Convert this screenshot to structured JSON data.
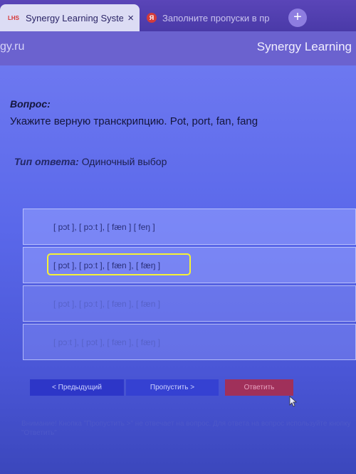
{
  "browser": {
    "tabs": [
      {
        "favicon": "LHS",
        "title": "Synergy Learning System",
        "close": "×"
      },
      {
        "favicon": "Я",
        "title": "Заполните пропуски в пр"
      }
    ],
    "new_tab": "+",
    "url": "gy.ru"
  },
  "site": {
    "title": "Synergy Learning"
  },
  "question": {
    "label": "Вопрос:",
    "text": "Укажите верную транскрипцию. Pot, port, fan, fang"
  },
  "answer_type": {
    "label": "Тип ответа:",
    "value": "Одиночный выбор"
  },
  "options": [
    "[ pɔt ], [ pɔːt ], [ fæn ] [ feŋ ]",
    "[ pɔt ], [ pɔːt ], [ fæn ], [ fæŋ ]",
    "[ pɔt ], [ pɔːt ], [ fæn ], [ fæn ]",
    "[ pɔːt ], [ pɔt ], [ fæn ], [ fæŋ ]"
  ],
  "buttons": {
    "prev": "< Предыдущий",
    "skip": "Пропустить >",
    "answer": "Ответить"
  },
  "note": "Внимание! Кнопка \"Пропустить >\" не отвечает на вопрос. Для ответа на вопрос используйте кнопку \"Ответить\"",
  "colors": {
    "highlight": "#f6f235",
    "answer_button": "#a0305a",
    "nav_button": "#2d36c8"
  }
}
